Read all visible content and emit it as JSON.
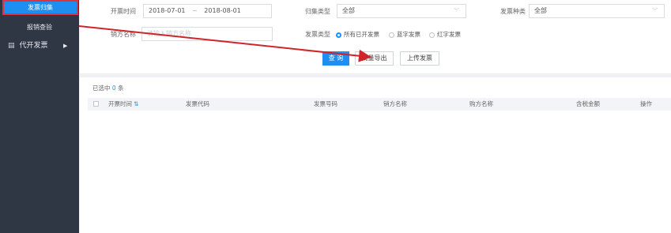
{
  "sidebar": {
    "active_item": "发票归集",
    "verify_item": "报销查验",
    "group": {
      "icon": "layers-icon",
      "label": "代开发票"
    }
  },
  "filters": {
    "invoice_time_label": "开票时间",
    "date_start": "2018-07-01",
    "date_sep": "~",
    "date_end": "2018-08-01",
    "collect_type_label": "归集类型",
    "collect_type_value": "全部",
    "invoice_kind_label": "发票种类",
    "invoice_kind_value": "全部",
    "seller_label": "销方名称",
    "seller_placeholder": "请输入销方名称",
    "invoice_type_label": "发票类型",
    "radio_options": [
      "所有已开发票",
      "蓝字发票",
      "红字发票"
    ],
    "radio_selected": 0
  },
  "buttons": {
    "query": "查 询",
    "export": "批量导出",
    "upload": "上传发票"
  },
  "list": {
    "selected_prefix": "已选中",
    "selected_count": "0",
    "selected_suffix": "条",
    "columns": [
      "开票时间",
      "发票代码",
      "发票号码",
      "销方名称",
      "购方名称",
      "含税金额",
      "操作"
    ],
    "sort_icon": "sort-icon"
  },
  "colors": {
    "accent": "#1e8ff0",
    "sidebar_bg": "#2f3744",
    "highlight_border": "#d93640",
    "annotation_arrow": "#d0242b"
  }
}
